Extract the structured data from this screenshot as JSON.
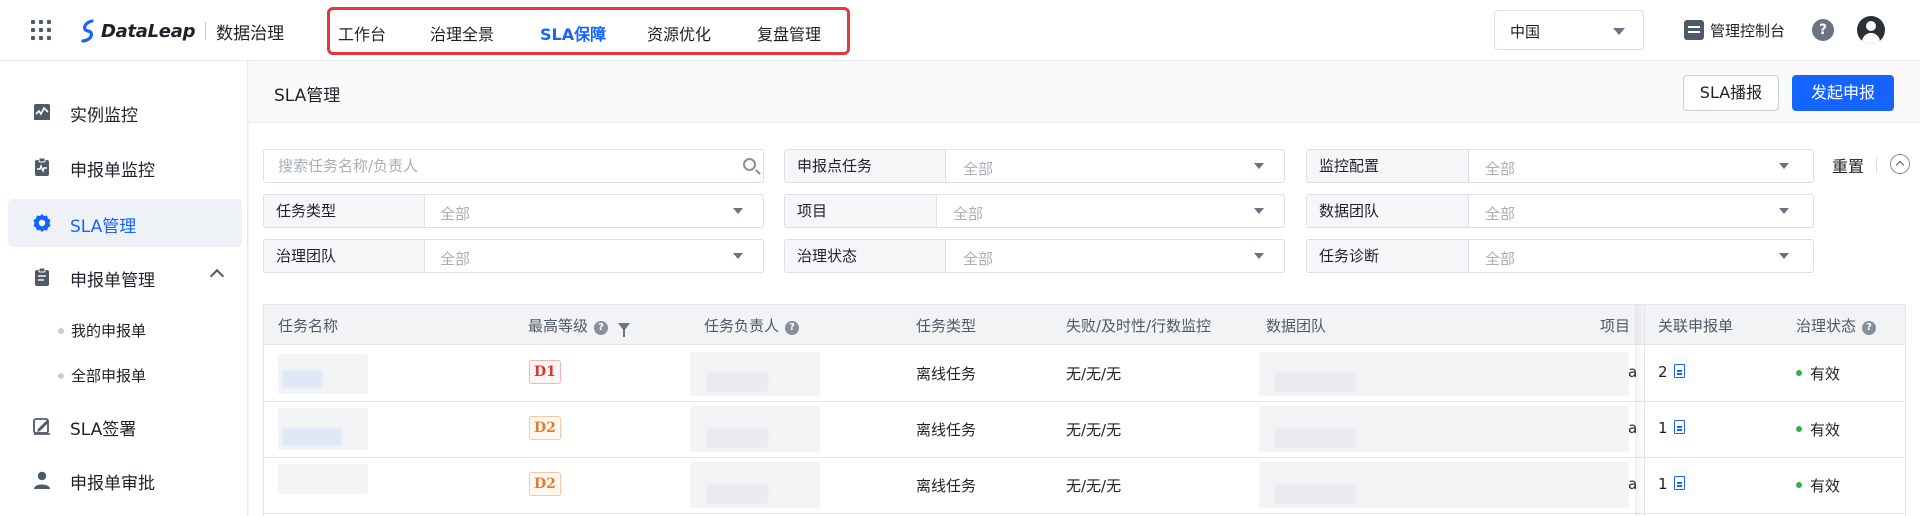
{
  "header": {
    "logo_text": "DataLeap",
    "product_name": "数据治理",
    "nav_items": [
      {
        "label": "工作台",
        "active": false
      },
      {
        "label": "治理全景",
        "active": false
      },
      {
        "label": "SLA保障",
        "active": true
      },
      {
        "label": "资源优化",
        "active": false
      },
      {
        "label": "复盘管理",
        "active": false
      }
    ],
    "region": "中国",
    "console_label": "管理控制台",
    "help_icon_text": "?"
  },
  "sidebar": {
    "items": [
      {
        "label": "实例监控",
        "icon": "line-chart-icon"
      },
      {
        "label": "申报单监控",
        "icon": "clipboard-pulse-icon"
      },
      {
        "label": "SLA管理",
        "icon": "gear-icon",
        "active": true
      },
      {
        "label": "申报单管理",
        "icon": "clipboard-list-icon",
        "expanded": true
      },
      {
        "label": "SLA签署",
        "icon": "sign-pen-icon"
      },
      {
        "label": "申报单审批",
        "icon": "user-icon"
      }
    ],
    "sub_items": [
      "我的申报单",
      "全部申报单"
    ]
  },
  "page": {
    "title": "SLA管理",
    "btn_broadcast": "SLA播报",
    "btn_submit": "发起申报"
  },
  "filters": {
    "search_placeholder": "搜索任务名称/负责人",
    "fields": [
      {
        "label": "申报点任务",
        "value": "全部"
      },
      {
        "label": "监控配置",
        "value": "全部"
      },
      {
        "label": "任务类型",
        "value": "全部"
      },
      {
        "label": "项目",
        "value": "全部"
      },
      {
        "label": "数据团队",
        "value": "全部"
      },
      {
        "label": "治理团队",
        "value": "全部"
      },
      {
        "label": "治理状态",
        "value": "全部"
      },
      {
        "label": "任务诊断",
        "value": "全部"
      }
    ],
    "reset_label": "重置"
  },
  "table": {
    "columns": [
      "任务名称",
      "最高等级",
      "任务负责人",
      "任务类型",
      "失败/及时性/行数监控",
      "数据团队",
      "项目",
      "关联申报单",
      "治理状态"
    ],
    "rows": [
      {
        "level": "D1",
        "task_type": "离线任务",
        "monitor": "无/无/无",
        "project": "a",
        "linked_count": "2",
        "status": "有效"
      },
      {
        "level": "D2",
        "task_type": "离线任务",
        "monitor": "无/无/无",
        "project": "a",
        "linked_count": "1",
        "status": "有效"
      },
      {
        "level": "D2",
        "task_type": "离线任务",
        "monitor": "无/无/无",
        "project": "a",
        "linked_count": "1",
        "status": "有效"
      }
    ]
  },
  "colors": {
    "primary": "#1664ff",
    "highlight_box": "#e5383b",
    "level_d1": "#e0312b",
    "level_d2": "#e97a2c",
    "status_green": "#2bb24a"
  }
}
